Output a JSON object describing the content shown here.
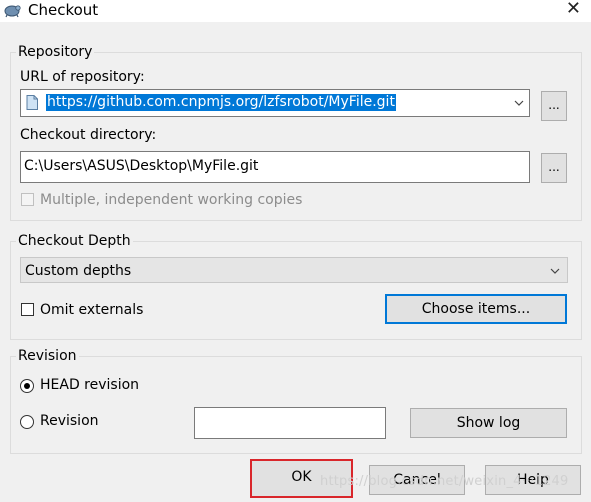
{
  "window": {
    "title": "Checkout",
    "close_glyph": "✕"
  },
  "repository": {
    "legend": "Repository",
    "url_label": "URL of repository:",
    "url_value": "https://github.com.cnpmjs.org/lzfsrobot/MyFile.git",
    "browse_label": "...",
    "dir_label": "Checkout directory:",
    "dir_value": "C:\\Users\\ASUS\\Desktop\\MyFile.git",
    "multiple_copies_label": "Multiple, independent working copies"
  },
  "depth": {
    "legend": "Checkout Depth",
    "selected": "Custom depths",
    "omit_externals_label": "Omit externals",
    "choose_items_label": "Choose items..."
  },
  "revision": {
    "legend": "Revision",
    "head_label": "HEAD revision",
    "revision_label": "Revision",
    "revision_value": "",
    "show_log_label": "Show log"
  },
  "buttons": {
    "ok": "OK",
    "cancel": "Cancel",
    "help": "Help"
  },
  "watermark": "https://blog.csdn.net/weixin_4···1249",
  "colors": {
    "accent": "#0078d7",
    "highlight_red": "#d9262b"
  }
}
